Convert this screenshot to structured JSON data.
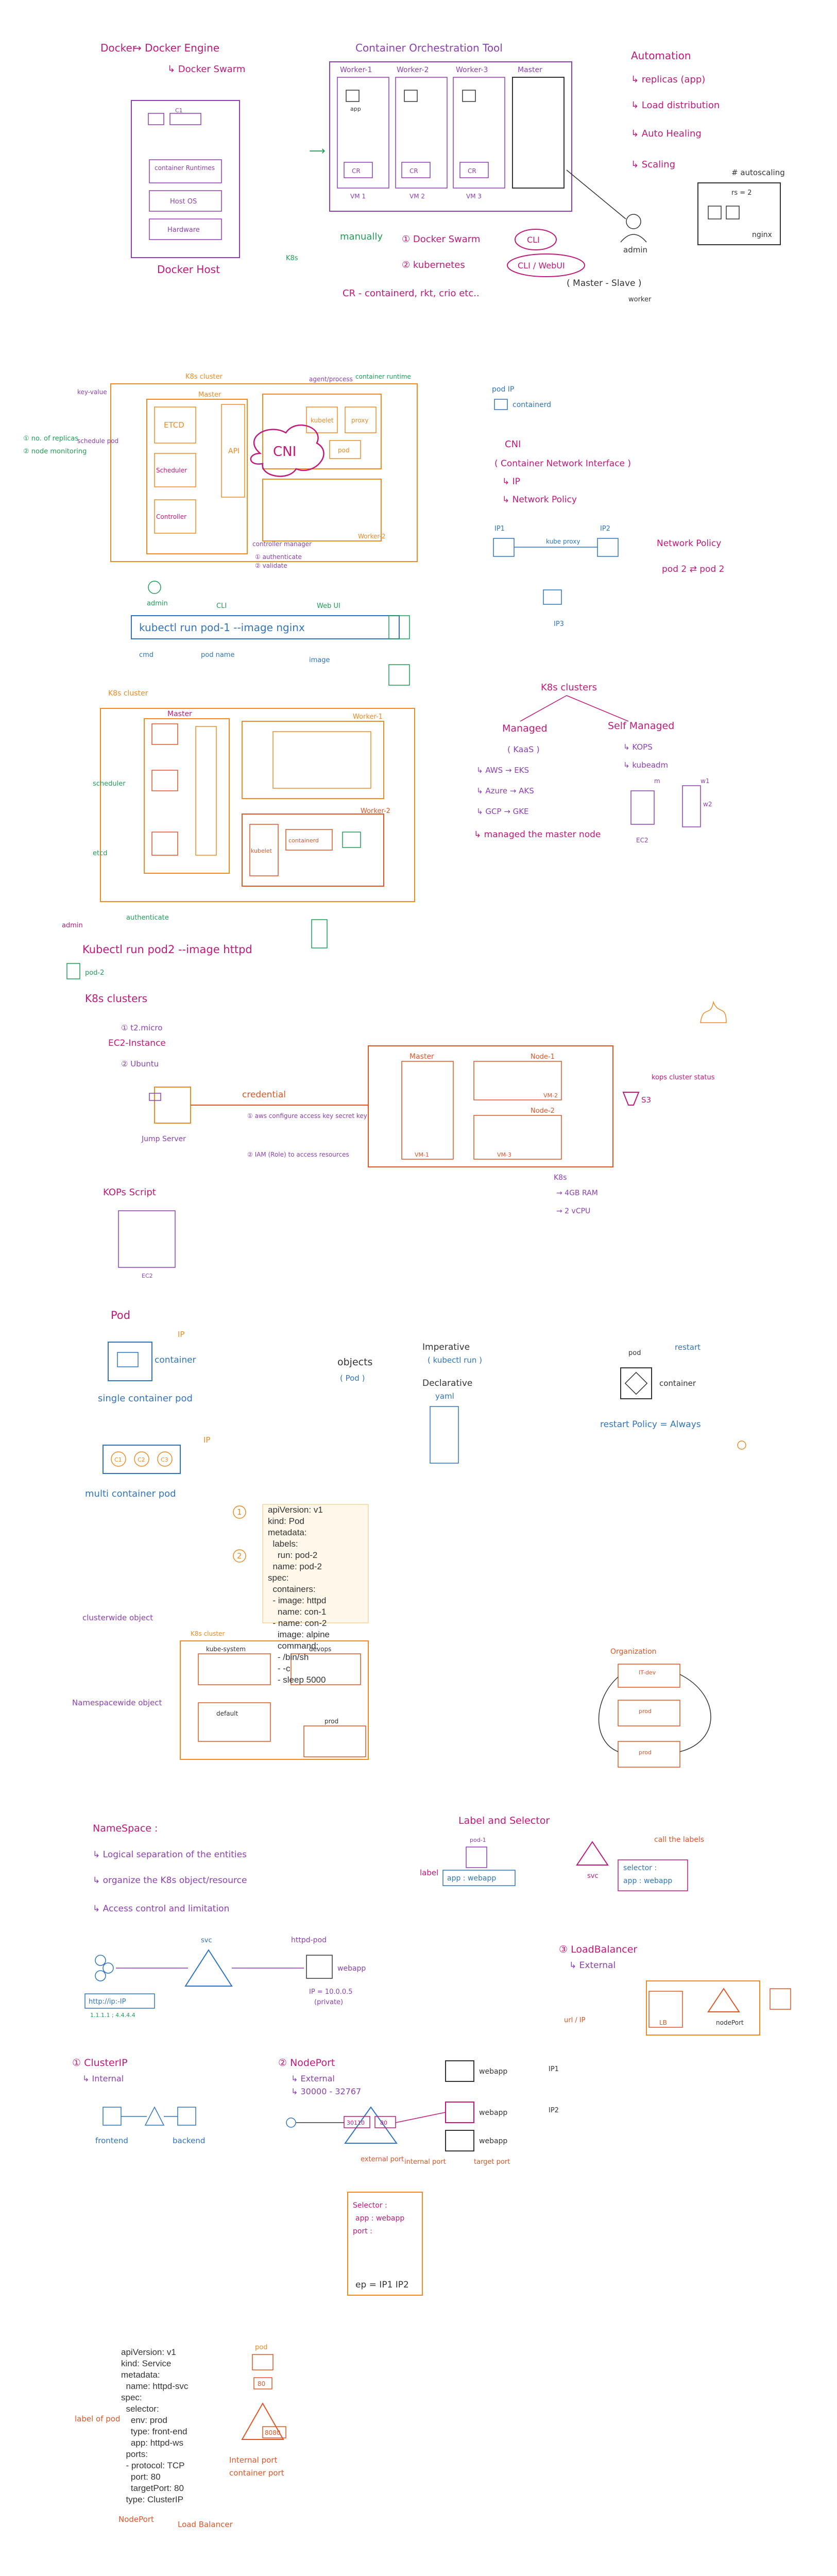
{
  "colors": {
    "magenta": "#c2187a",
    "purple": "#8e3fb5",
    "green": "#1f9d55",
    "blue": "#2f74c0",
    "orange": "#f08a24",
    "red": "#e05525",
    "dark": "#333333"
  },
  "sec1": {
    "docker": "Docker",
    "docker_engine": "→ Docker Engine",
    "docker_swarm": "↳ Docker Swarm",
    "c1": "C1",
    "c2": "C2",
    "container_runtimes": "container Runtimes",
    "host_os": "Host OS",
    "hardware": "Hardware",
    "docker_host": "Docker Host",
    "cot_title": "Container Orchestration Tool",
    "worker1": "Worker-1",
    "worker2": "Worker-2",
    "worker3": "Worker-3",
    "master": "Master",
    "app": "app",
    "cr": "CR",
    "vm1": "VM 1",
    "vm2": "VM 2",
    "vm3": "VM 3",
    "admin": "admin",
    "manually": "manually",
    "k8s": "K8s",
    "item1": "① Docker Swarm",
    "cli": "CLI",
    "item2": "② kubernetes",
    "cli_webui": "CLI / WebUI",
    "cr_line": "CR - containerd, rkt, crio etc..",
    "master_slave": "( Master - Slave )",
    "worker": "worker",
    "automation": "Automation",
    "replicas": "↳ replicas (app)",
    "load_dist": "↳ Load distribution",
    "auto_healing": "↳ Auto Healing",
    "scaling": "↳ Scaling",
    "autoscaling": "# autoscaling",
    "rs": "rs = 2",
    "nginx": "nginx"
  },
  "sec2": {
    "k8s_cluster": "K8s cluster",
    "master": "Master",
    "etcd": "ETCD",
    "api": "API",
    "scheduler": "Scheduler",
    "controller": "Controller",
    "cni": "CNI",
    "kubelet": "kubelet",
    "proxy": "proxy",
    "pod": "pod",
    "worker1": "Worker-1",
    "worker2": "Worker-2",
    "agent_process": "agent/process",
    "container_runtime": "container runtime",
    "admin": "admin",
    "cli": "CLI",
    "web_ui": "Web UI",
    "cmd": "kubectl run pod-1 --image nginx",
    "cmd_cmd": "cmd",
    "pod_name": "pod name",
    "image": "image",
    "controller_mgr": "controller manager",
    "authenticate": "① authenticate",
    "validate": "② validate",
    "key_value": "key-value",
    "schedule": "schedule pod",
    "notes": [
      "① no. of replicas",
      "② node monitoring"
    ],
    "ip_pod": "pod IP",
    "containerd": "containerd",
    "cni_title": "CNI",
    "cni_full": "( Container Network Interface )",
    "cni_ip": "↳ IP",
    "cni_np": "↳ Network Policy",
    "ip1": "IP1",
    "ip2": "IP2",
    "ip3": "IP3",
    "kube_proxy": "kube proxy",
    "network_policy": "Network Policy",
    "pod2_pod2": "pod 2 ⇄ pod 2"
  },
  "sec3": {
    "k8s_cluster": "K8s cluster",
    "master": "Master",
    "worker1": "Worker-1",
    "worker2": "Worker-2",
    "scheduler": "scheduler",
    "etcd": "etcd",
    "kubelet": "kubelet",
    "containerd": "containerd",
    "cmd": "Kubectl run pod2 --image httpd",
    "admin": "admin",
    "authenticate": "authenticate",
    "pod2": "pod-2",
    "k8s_clusters": "K8s clusters",
    "managed": "Managed",
    "self_managed": "Self Managed",
    "kaas": "( KaaS )",
    "eks": "↳ AWS → EKS",
    "aks": "↳ Azure → AKS",
    "gke": "↳ GCP → GKE",
    "managed_master": "↳ managed the master node",
    "kops": "↳ KOPS",
    "kubeadm": "↳ kubeadm",
    "m": "m",
    "w1": "w1",
    "w2": "w2",
    "ec2": "EC2"
  },
  "sec4": {
    "title": "K8s clusters",
    "t2micro": "① t2.micro",
    "ec2_instance": "EC2-Instance",
    "ubuntu": "② Ubuntu",
    "jump_server": "Jump Server",
    "credential": "credential",
    "aws_configure": "① aws configure access key secret key",
    "iam_role": "② IAM (Role) to access resources",
    "master": "Master",
    "node1": "Node-1",
    "node2": "Node-2",
    "vm1": "VM-1",
    "vm2": "VM-2",
    "vm3": "VM-3",
    "s3": "S3",
    "kops_state": "kops cluster status",
    "kops_script": "KOPs Script",
    "ec2": "EC2",
    "k8s": "K8s",
    "cpu": "→ 2 vCPU",
    "ram": "→ 4GB RAM"
  },
  "sec5": {
    "pod": "Pod",
    "ip": "IP",
    "container": "container",
    "single": "single container pod",
    "multi": "multi container pod",
    "c1": "C1",
    "c2": "C2",
    "c3": "C3",
    "objects": "objects",
    "pod_paren": "( Pod )",
    "imperative": "Imperative",
    "kubectl_run": "( kubectl run )",
    "declarative": "Declarative",
    "yaml": "yaml",
    "pod_label": "pod",
    "restart": "restart",
    "container2": "container",
    "restart_policy": "restart Policy = Always",
    "yaml_lines": [
      "apiVersion: v1",
      "kind: Pod",
      "metadata:",
      "  labels:",
      "    run: pod-2",
      "  name: pod-2",
      "spec:",
      "  containers:",
      "  - image: httpd",
      "    name: con-1",
      "  - name: con-2",
      "    image: alpine",
      "    command:",
      "    - /bin/sh",
      "    - -c",
      "    - sleep 5000"
    ],
    "n1": "1",
    "n2": "2"
  },
  "sec6": {
    "clusterwide": "clusterwide object",
    "namespacewide": "Namespacewide object",
    "k8s_cluster": "K8s cluster",
    "kube_system": "kube-system",
    "devops": "devops",
    "default": "default",
    "prod": "prod",
    "organization": "Organization",
    "ns1": "IT-dev",
    "ns2": "prod",
    "ns3": "prod",
    "namespace": "NameSpace :",
    "ns_a": "↳ Logical separation of the entities",
    "ns_b": "↳ organize the K8s object/resource",
    "ns_c": "↳ Access control and limitation",
    "label_selector": "Label and Selector",
    "pod1": "pod-1",
    "label": "label",
    "app_webapp": "app : webapp",
    "svc": "svc",
    "selector": "selector :",
    "call_labels": "call the labels",
    "app_webapp2": "app : webapp"
  },
  "sec7": {
    "svc": "svc",
    "httpd_pod": "httpd-pod",
    "webapp": "webapp",
    "ip_val": "IP = 10.0.0.5",
    "private": "(private)",
    "url": "http://ip:-IP",
    "ip_list": "1.1.1.1 ; 4.4.4.4",
    "lb_title": "③ LoadBalancer",
    "lb_external": "↳ External",
    "lb": "LB",
    "nodeport_label": "nodePort",
    "ipport": "url / IP",
    "clusterip": "① ClusterIP",
    "clusterip_internal": "↳ Internal",
    "frontend": "frontend",
    "backend": "backend",
    "nodeport": "② NodePort",
    "np_external": "↳ External",
    "np_range": "↳ 30000 - 32767",
    "np1": "30110",
    "np2": "80",
    "webapp1": "webapp",
    "webapp2": "webapp",
    "webapp3": "webapp",
    "ip1": "IP1",
    "ip2": "IP2",
    "internal_port": "internal port",
    "target_port": "target port",
    "external_port": "external port",
    "selector": "Selector :",
    "app_webapp": "app : webapp",
    "port": "port :",
    "ep": "ep = IP1  IP2"
  },
  "sec8": {
    "yaml_lines": [
      "apiVersion: v1",
      "kind: Service",
      "metadata:",
      "  name: httpd-svc",
      "spec:",
      "  selector:",
      "    env: prod",
      "    type: front-end",
      "    app: httpd-ws",
      "  ports:",
      "  - protocol: TCP",
      "    port: 80",
      "    targetPort: 80",
      "  type: ClusterIP"
    ],
    "label_of_pod": "label of pod",
    "internal_port": "Internal port",
    "container_port": "container port",
    "pod": "pod",
    "p80": "80",
    "p8080": "8080",
    "nodeport": "NodePort",
    "loadbalancer": "Load Balancer"
  }
}
